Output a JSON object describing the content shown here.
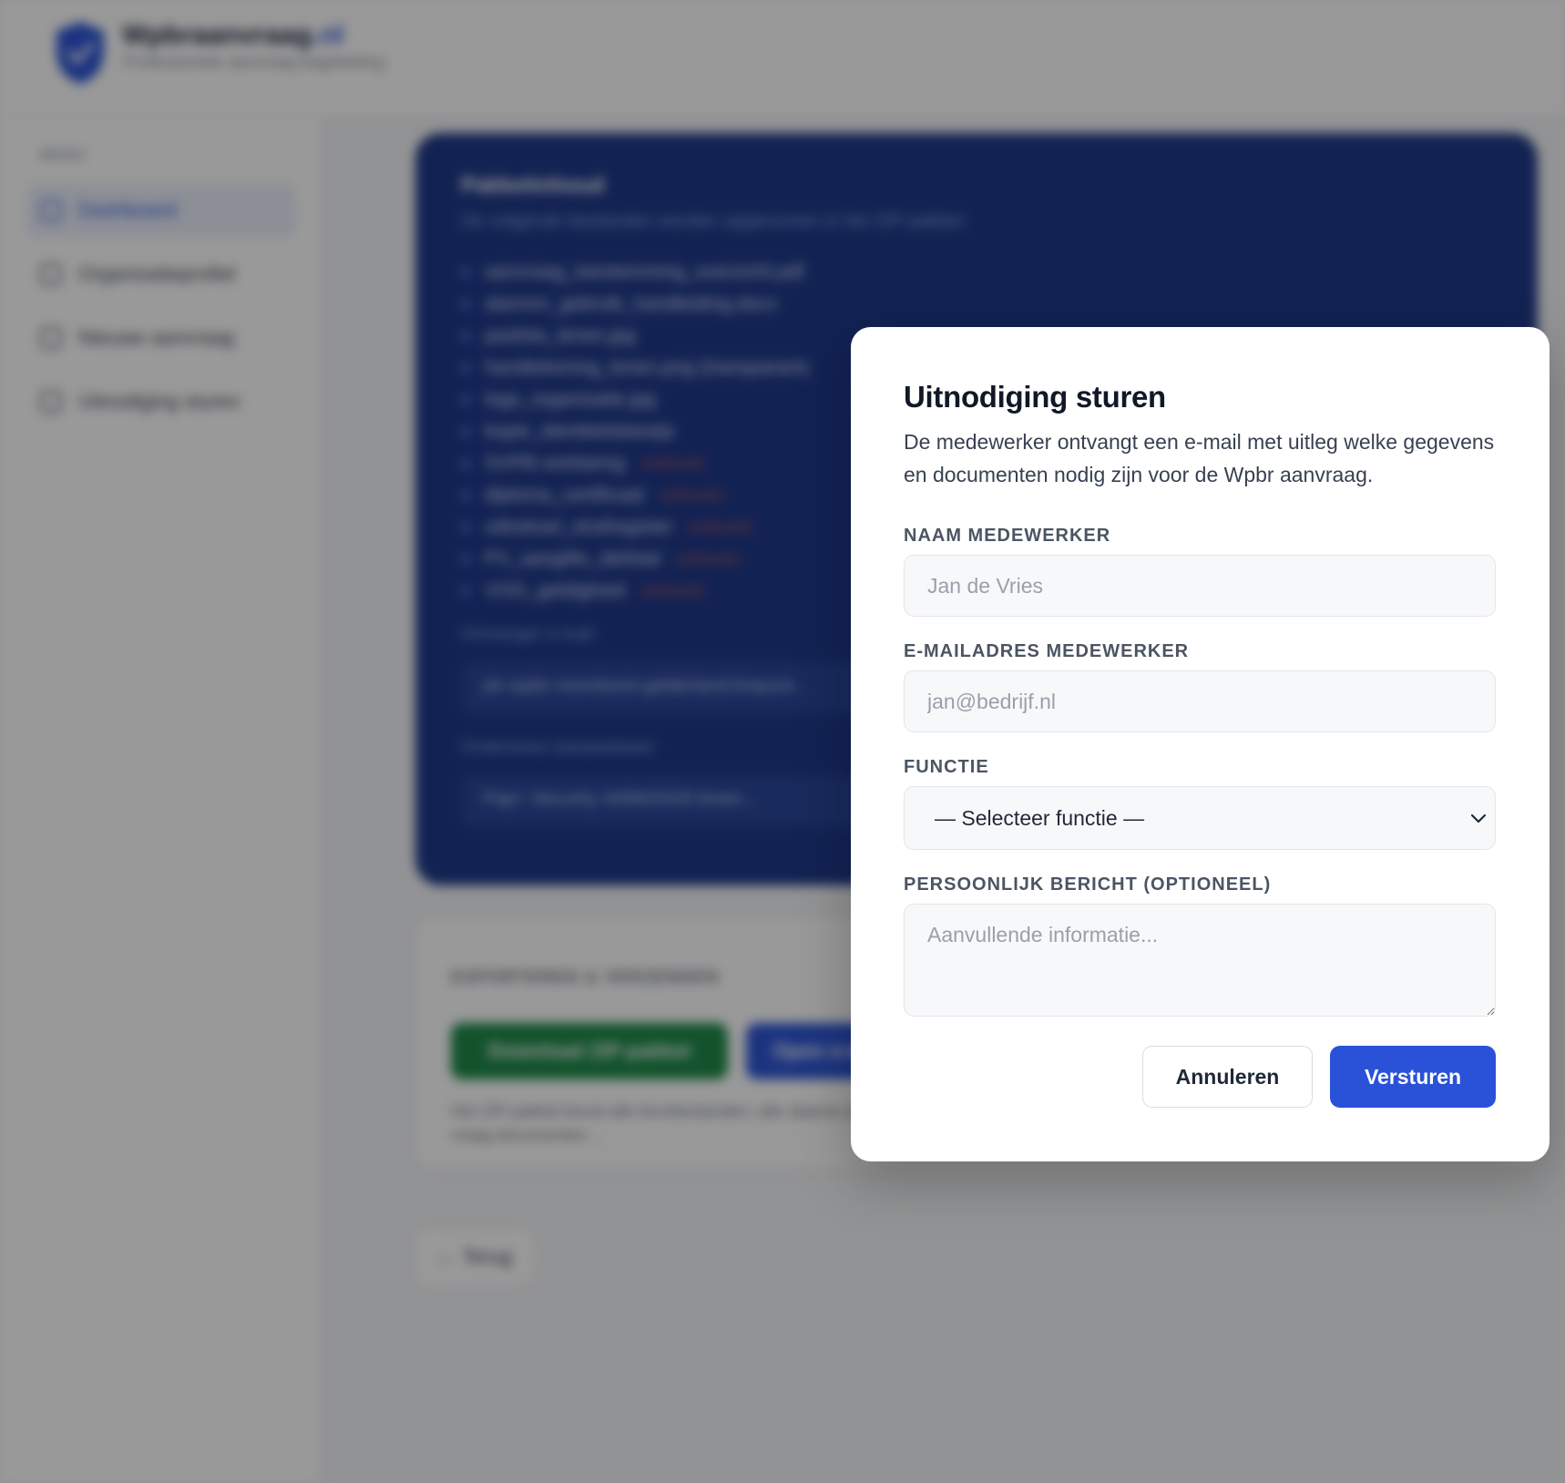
{
  "colors": {
    "accent": "#2a52d9",
    "hero_bg": "#1f3a8a",
    "export_green": "#1f8a4a",
    "missing_red": "#d35a5a"
  },
  "header": {
    "brand_name": "Wpbraanvraag",
    "brand_tld": ".nl",
    "brand_tagline": "Professionele aanvraag begeleiding"
  },
  "sidebar": {
    "menu_label": "MENU",
    "items": [
      {
        "label": "Dashboard",
        "icon": "grid-icon"
      },
      {
        "label": "Organisatieprofiel",
        "icon": "building-icon"
      },
      {
        "label": "Nieuwe aanvraag",
        "icon": "document-icon"
      },
      {
        "label": "Uitnodiging sturen",
        "icon": "mail-icon"
      }
    ]
  },
  "hero": {
    "title": "Pakketinhoud",
    "subtitle": "De volgende bestanden worden opgenomen in het ZIP-pakket:",
    "files": [
      {
        "name": "aanvraag_toestemming_overzicht.pdf",
        "status": ""
      },
      {
        "name": "alarmnr_gebruik_handleiding.docx",
        "status": ""
      },
      {
        "name": "pasfoto_lenen.jpg",
        "status": ""
      },
      {
        "name": "handtekening_lenen.png (transparant)",
        "status": ""
      },
      {
        "name": "logo_organisatie.jpg",
        "status": ""
      },
      {
        "name": "kopie_identiteitsbewijs",
        "status": ""
      },
      {
        "name": "SVPB-verklaring",
        "status": "ontbreekt"
      },
      {
        "name": "diploma_certificaat",
        "status": "ontbreekt"
      },
      {
        "name": "uittreksel_strafregister",
        "status": "ontbreekt"
      },
      {
        "name": "PV_aangifte_diefstal",
        "status": "ontbreekt"
      },
      {
        "name": "VOG_geldigheid",
        "status": "ontbreekt"
      }
    ],
    "email_label": "Ontvanger e-mail",
    "email_value": "ptr-wpbr-noordoost-gelderland.kmpunt...",
    "subject_label": "Onderwerp (aanpasbaar)",
    "subject_value": "Pap+ Security 440M/2020 lenen..."
  },
  "export": {
    "title": "EXPORTEREN & VERZENDEN",
    "download_label": "Download ZIP-pakket",
    "open_label": "Open e-mail",
    "note": "Het ZIP-pakket bevat alle bronbestanden; alle daarna zijn, inclusief, vraag documenten ..."
  },
  "back_label": "← Terug",
  "modal": {
    "title": "Uitnodiging sturen",
    "description": "De medewerker ontvangt een e-mail met uitleg welke gegevens en documenten nodig zijn voor de Wpbr aanvraag.",
    "name_label": "NAAM MEDEWERKER",
    "name_placeholder": "Jan de Vries",
    "email_label": "E-MAILADRES MEDEWERKER",
    "email_placeholder": "jan@bedrijf.nl",
    "function_label": "FUNCTIE",
    "function_selected": "— Selecteer functie —",
    "message_label": "PERSOONLIJK BERICHT (OPTIONEEL)",
    "message_placeholder": "Aanvullende informatie...",
    "cancel_label": "Annuleren",
    "send_label": "Versturen"
  }
}
